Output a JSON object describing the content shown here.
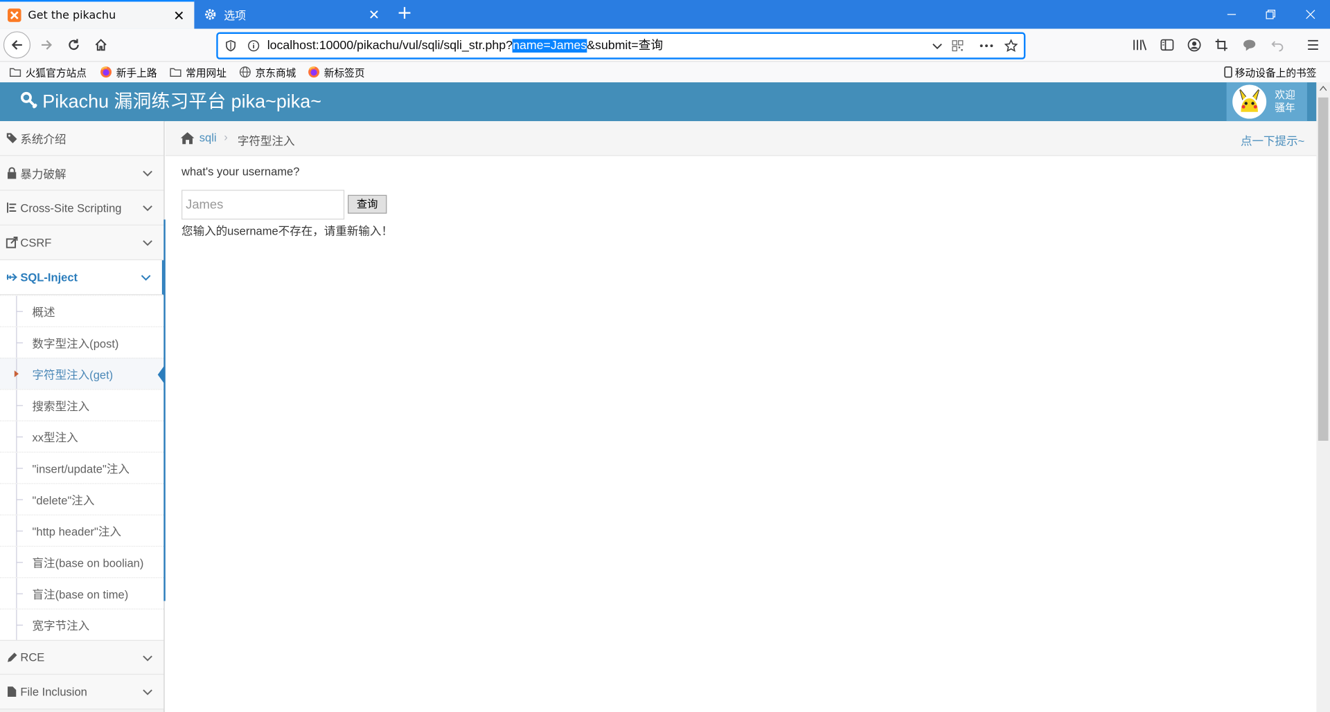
{
  "browser": {
    "tabs": [
      {
        "title": "Get the pikachu",
        "active": true,
        "icon": "xampp-icon"
      },
      {
        "title": "选项",
        "active": false,
        "icon": "gear-icon"
      }
    ],
    "url_before": "localhost:10000/pikachu/vul/sqli/sqli_str.php?",
    "url_selected": "name=James",
    "url_after": "&submit=查询",
    "bookmarks": [
      {
        "label": "火狐官方站点",
        "icon": "folder-icon"
      },
      {
        "label": "新手上路",
        "icon": "firefox-icon"
      },
      {
        "label": "常用网址",
        "icon": "folder-icon"
      },
      {
        "label": "京东商城",
        "icon": "globe-icon"
      },
      {
        "label": "新标签页",
        "icon": "firefox-icon"
      }
    ],
    "mobile_bookmarks": "移动设备上的书签",
    "accent": "#2a7de1"
  },
  "header": {
    "brand": "Pikachu 漏洞练习平台 pika~pika~",
    "welcome_line1": "欢迎",
    "welcome_line2": "骚年",
    "color": "#438eb9"
  },
  "sidebar": {
    "items": [
      {
        "label": "系统介绍",
        "icon": "tags-icon",
        "expandable": false
      },
      {
        "label": "暴力破解",
        "icon": "lock-icon",
        "expandable": true
      },
      {
        "label": "Cross-Site Scripting",
        "icon": "list-icon",
        "expandable": true
      },
      {
        "label": "CSRF",
        "icon": "share-icon",
        "expandable": true
      },
      {
        "label": "SQL-Inject",
        "icon": "plane-icon",
        "expandable": true,
        "open": true
      },
      {
        "label": "RCE",
        "icon": "pencil-icon",
        "expandable": true
      },
      {
        "label": "File Inclusion",
        "icon": "file-icon",
        "expandable": true
      }
    ],
    "sqli_subitems": [
      "概述",
      "数字型注入(post)",
      "字符型注入(get)",
      "搜索型注入",
      "xx型注入",
      "\"insert/update\"注入",
      "\"delete\"注入",
      "\"http header\"注入",
      "盲注(base on boolian)",
      "盲注(base on time)",
      "宽字节注入"
    ],
    "active_subitem": "字符型注入(get)"
  },
  "breadcrumb": {
    "section": "sqli",
    "current": "字符型注入",
    "hint": "点一下提示~"
  },
  "main": {
    "prompt": "what's your username?",
    "input_value": "James",
    "submit_label": "查询",
    "result_message": "您输入的username不存在，请重新输入！"
  }
}
